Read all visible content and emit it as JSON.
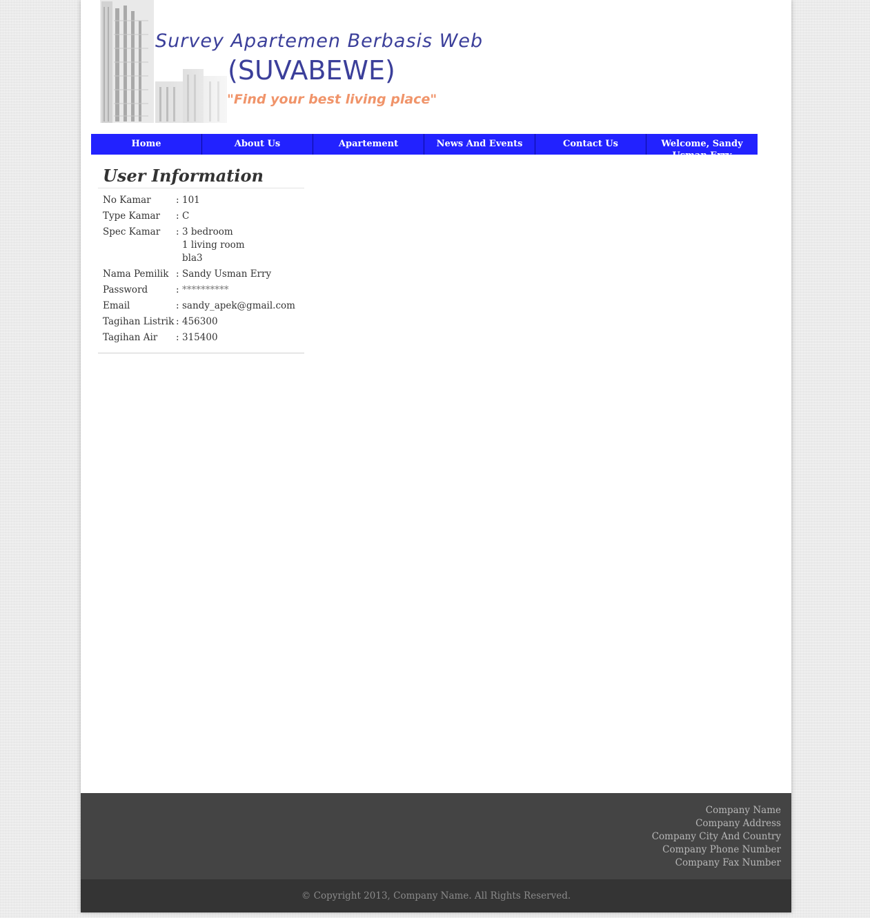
{
  "header": {
    "title": "Survey Apartemen Berbasis Web",
    "acronym": "(SUVABEWE)",
    "tagline": "\"Find your best living place\""
  },
  "nav": {
    "items": [
      {
        "label": "Home"
      },
      {
        "label": "About Us"
      },
      {
        "label": "Apartement"
      },
      {
        "label": "News And Events"
      },
      {
        "label": "Contact Us"
      },
      {
        "label": "Welcome, Sandy Usman Erry"
      }
    ]
  },
  "user_info": {
    "title": "User Information",
    "colon": ":",
    "rows": [
      {
        "label": "No Kamar",
        "value": "101"
      },
      {
        "label": "Type Kamar",
        "value": "C"
      },
      {
        "label": "Spec Kamar",
        "value_lines": [
          "3 bedroom",
          "1 living room",
          "bla3"
        ]
      },
      {
        "label": "Nama Pemilik",
        "value": "Sandy Usman Erry"
      },
      {
        "label": "Password",
        "value": "**********"
      },
      {
        "label": "Email",
        "value": "sandy_apek@gmail.com"
      },
      {
        "label": "Tagihan Listrik",
        "value": "456300"
      },
      {
        "label": "Tagihan Air",
        "value": "315400"
      }
    ]
  },
  "footer": {
    "company_lines": [
      "Company Name",
      "Company Address",
      "Company City And Country",
      "Company Phone Number",
      "Company Fax Number"
    ],
    "copyright": "© Copyright 2013, Company Name. All Rights Reserved."
  },
  "colors": {
    "nav_bg": "#2222ff",
    "title_blue": "#3b3f9a",
    "tagline_orange": "#f0946a",
    "footer_dark": "#444444",
    "footer_darker": "#343434"
  }
}
